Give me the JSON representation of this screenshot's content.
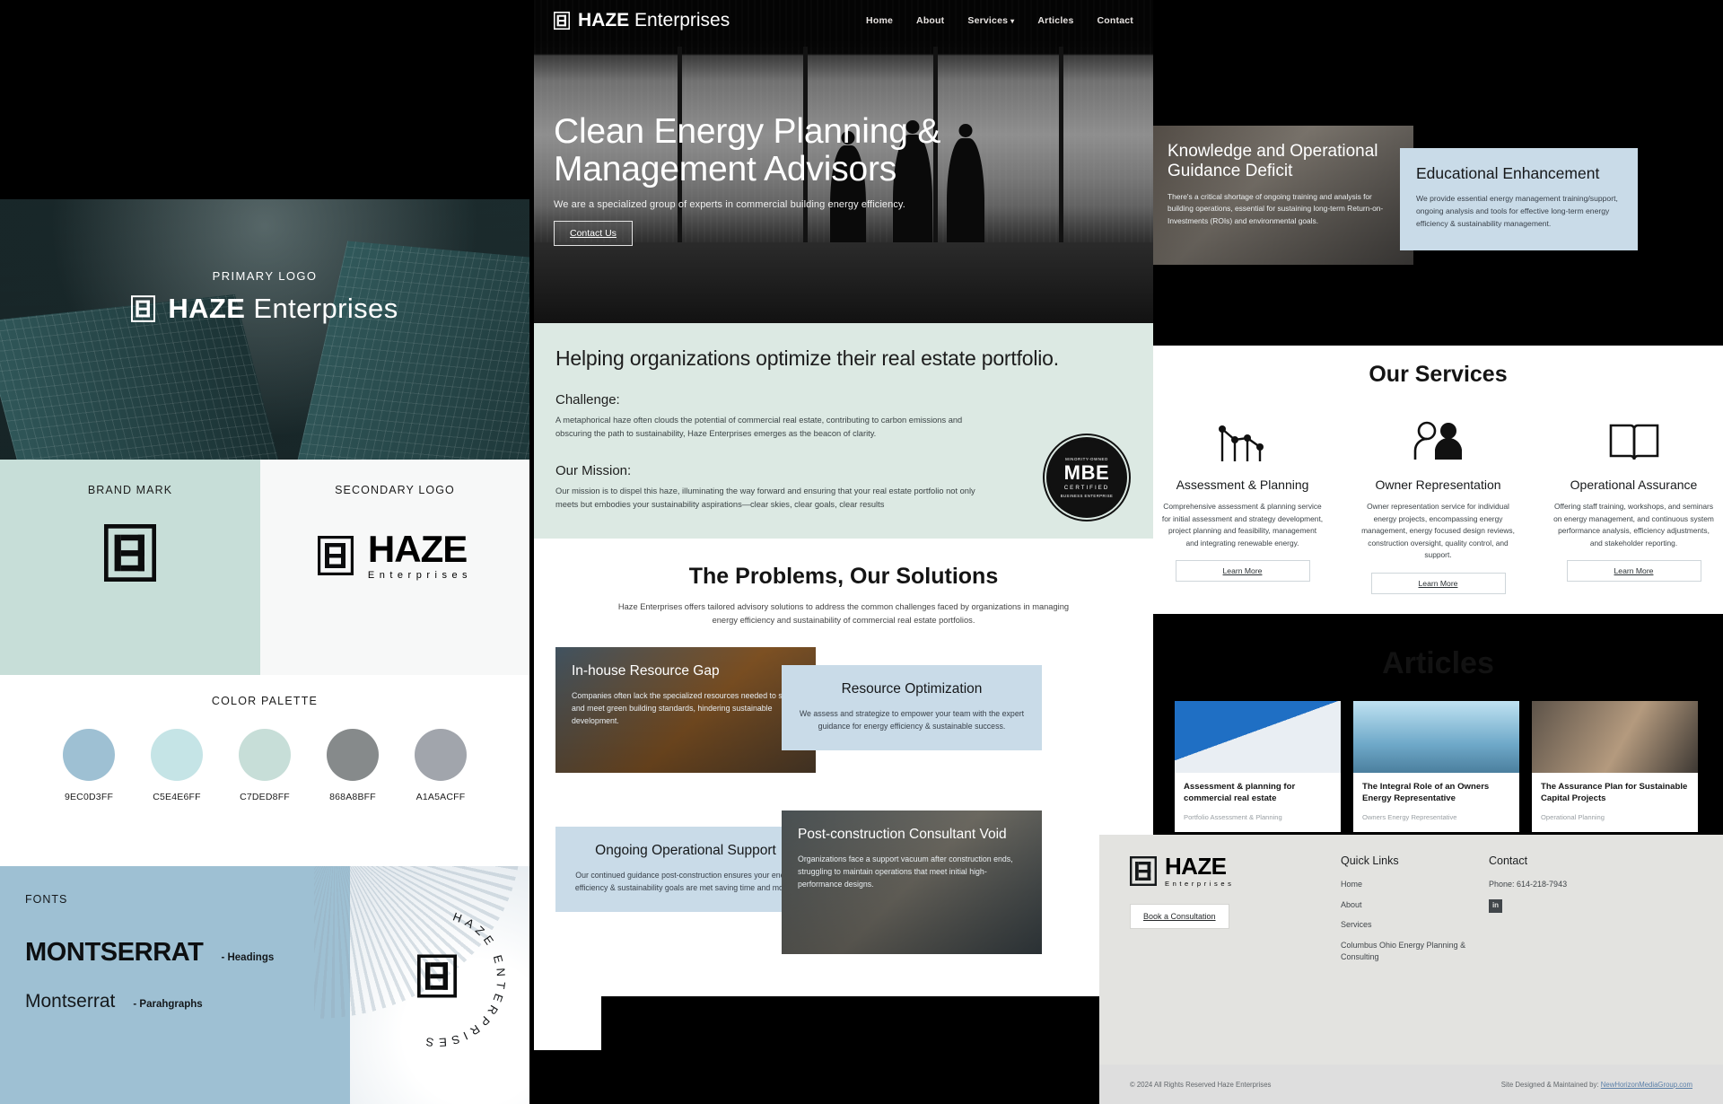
{
  "brand": {
    "primary_logo_label": "PRIMARY LOGO",
    "wordmark_bold": "HAZE",
    "wordmark_light": "Enterprises",
    "brand_mark_label": "BRAND MARK",
    "secondary_logo_label": "SECONDARY LOGO",
    "secondary_word": "HAZE",
    "secondary_sub": "Enterprises",
    "palette_title": "COLOR PALETTE",
    "palette": [
      {
        "hex": "#9EC0D3",
        "code": "9EC0D3FF"
      },
      {
        "hex": "#C5E4E6",
        "code": "C5E4E6FF"
      },
      {
        "hex": "#C7DED8",
        "code": "C7DED8FF"
      },
      {
        "hex": "#868A8B",
        "code": "868A8BFF"
      },
      {
        "hex": "#A1A5AC",
        "code": "A1A5ACFF"
      }
    ],
    "fonts_label": "FONTS",
    "heading_font": "MONTSERRAT",
    "heading_note": "-  Headings",
    "paragraph_font": "Montserrat",
    "paragraph_note": "-  Parahgraphs",
    "circle_logo_text": "HAZE ENTERPRISES"
  },
  "site": {
    "nav": {
      "logo_bold": "HAZE",
      "logo_light": "Enterprises",
      "links": [
        {
          "label": "Home"
        },
        {
          "label": "About"
        },
        {
          "label": "Services",
          "caret": "⌄"
        },
        {
          "label": "Articles"
        },
        {
          "label": "Contact"
        }
      ]
    },
    "hero": {
      "title": "Clean Energy Planning & Management Advisors",
      "subtitle": "We are a specialized group of experts in commercial building energy efficiency.",
      "cta": "Contact Us"
    },
    "mission": {
      "title": "Helping organizations optimize their real estate portfolio.",
      "challenge_label": "Challenge:",
      "challenge_text": "A metaphorical haze often clouds the potential of commercial real estate, contributing to carbon emissions and obscuring the path to sustainability, Haze Enterprises emerges as the beacon of clarity.",
      "mission_label": "Our Mission:",
      "mission_text": "Our mission is to dispel this haze, illuminating the way forward and ensuring that your real estate portfolio not only meets but embodies your sustainability aspirations—clear skies, clear goals, clear results",
      "badge_top": "MINORITY-OWNED",
      "badge_main": "MBE",
      "badge_sub": "CERTIFIED",
      "badge_bottom": "BUSINESS ENTERPRISE"
    },
    "problems": {
      "title": "The Problems, Our Solutions",
      "subtitle": "Haze Enterprises offers tailored advisory solutions to address the common challenges faced by organizations in managing energy efficiency and sustainability of commercial real estate portfolios.",
      "items": [
        {
          "heading": "In-house Resource Gap",
          "text": "Companies often lack the specialized resources needed to set and meet green building standards, hindering sustainable development."
        },
        {
          "heading": "Resource Optimization",
          "text": "We assess and strategize to empower your team with the expert guidance for energy efficiency & sustainable success."
        },
        {
          "heading": "Ongoing Operational Support",
          "text": "Our continued guidance post-construction ensures your energy efficiency & sustainability goals are met saving time and money"
        },
        {
          "heading": "Post-construction Consultant Void",
          "text": "Organizations face a support vacuum after construction ends, struggling to maintain operations that meet initial high-performance designs."
        }
      ]
    }
  },
  "right": {
    "knowledge_card": {
      "heading": "Knowledge and Operational Guidance Deficit",
      "text": "There's a critical shortage of ongoing training and analysis for building operations, essential for sustaining long-term Return-on-Investments (ROIs) and environmental goals."
    },
    "education_card": {
      "heading": "Educational Enhancement",
      "text": "We provide essential energy management training/support, ongoing analysis and tools for effective long-term energy efficiency & sustainability management."
    },
    "services": {
      "title": "Our Services",
      "items": [
        {
          "icon": "line-chart-icon",
          "title": "Assessment & Planning",
          "text": "Comprehensive assessment & planning service for initial assessment and strategy development, project planning and feasibility, management and integrating renewable energy.",
          "button": "Learn More"
        },
        {
          "icon": "people-icon",
          "title": "Owner Representation",
          "text": "Owner representation service for individual energy projects, encompassing energy management, energy focused design reviews, construction oversight, quality control, and support.",
          "button": "Learn More"
        },
        {
          "icon": "book-icon",
          "title": "Operational Assurance",
          "text": "Offering staff training, workshops, and seminars on energy management, and continuous system performance analysis, efficiency adjustments, and stakeholder reporting.",
          "button": "Learn More"
        }
      ]
    },
    "articles": {
      "title": "Articles",
      "items": [
        {
          "heading": "Assessment & planning for commercial real estate",
          "tag": "Portfolio Assessment & Planning"
        },
        {
          "heading": "The Integral Role of an Owners Energy Representative",
          "tag": "Owners Energy Representative"
        },
        {
          "heading": "The Assurance Plan for Sustainable Capital Projects",
          "tag": "Operational Planning"
        }
      ]
    },
    "footer": {
      "logo_word": "HAZE",
      "logo_sub": "Enterprises",
      "cta": "Book a Consultation",
      "quick_links_title": "Quick Links",
      "quick_links": [
        "Home",
        "About",
        "Services",
        "Columbus Ohio Energy Planning & Consulting"
      ],
      "contact_title": "Contact",
      "phone": "Phone: 614-218-7943",
      "linkedin": "in",
      "copyright": "© 2024 All Rights Reserved Haze Enterprises",
      "credit_prefix": "Site Designed & Maintained by:",
      "credit_link": "NewHorizonMediaGroup.com"
    }
  }
}
